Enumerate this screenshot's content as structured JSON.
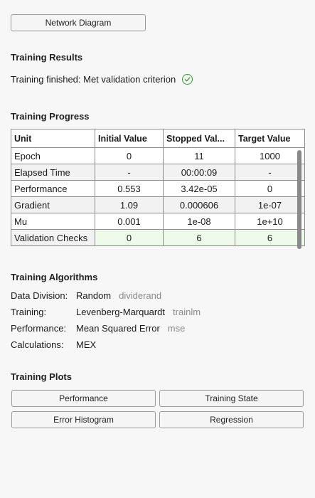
{
  "buttons": {
    "network_diagram": "Network Diagram"
  },
  "results": {
    "title": "Training Results",
    "status": "Training finished: Met validation criterion"
  },
  "progress": {
    "title": "Training Progress",
    "columns": [
      "Unit",
      "Initial Value",
      "Stopped Val...",
      "Target Value"
    ],
    "rows": [
      {
        "unit": "Epoch",
        "initial": "0",
        "stopped": "11",
        "target": "1000"
      },
      {
        "unit": "Elapsed Time",
        "initial": "-",
        "stopped": "00:00:09",
        "target": "-"
      },
      {
        "unit": "Performance",
        "initial": "0.553",
        "stopped": "3.42e-05",
        "target": "0"
      },
      {
        "unit": "Gradient",
        "initial": "1.09",
        "stopped": "0.000606",
        "target": "1e-07"
      },
      {
        "unit": "Mu",
        "initial": "0.001",
        "stopped": "1e-08",
        "target": "1e+10"
      },
      {
        "unit": "Validation Checks",
        "initial": "0",
        "stopped": "6",
        "target": "6"
      }
    ]
  },
  "algorithms": {
    "title": "Training Algorithms",
    "rows": [
      {
        "label": "Data Division:",
        "value": "Random",
        "code": "dividerand"
      },
      {
        "label": "Training:",
        "value": "Levenberg-Marquardt",
        "code": "trainlm"
      },
      {
        "label": "Performance:",
        "value": "Mean Squared Error",
        "code": "mse"
      },
      {
        "label": "Calculations:",
        "value": "MEX",
        "code": ""
      }
    ]
  },
  "plots": {
    "title": "Training Plots",
    "performance": "Performance",
    "training_state": "Training State",
    "error_histogram": "Error Histogram",
    "regression": "Regression"
  },
  "colors": {
    "check_green": "#2e9d2e",
    "highlight_row": "#eefbea"
  }
}
